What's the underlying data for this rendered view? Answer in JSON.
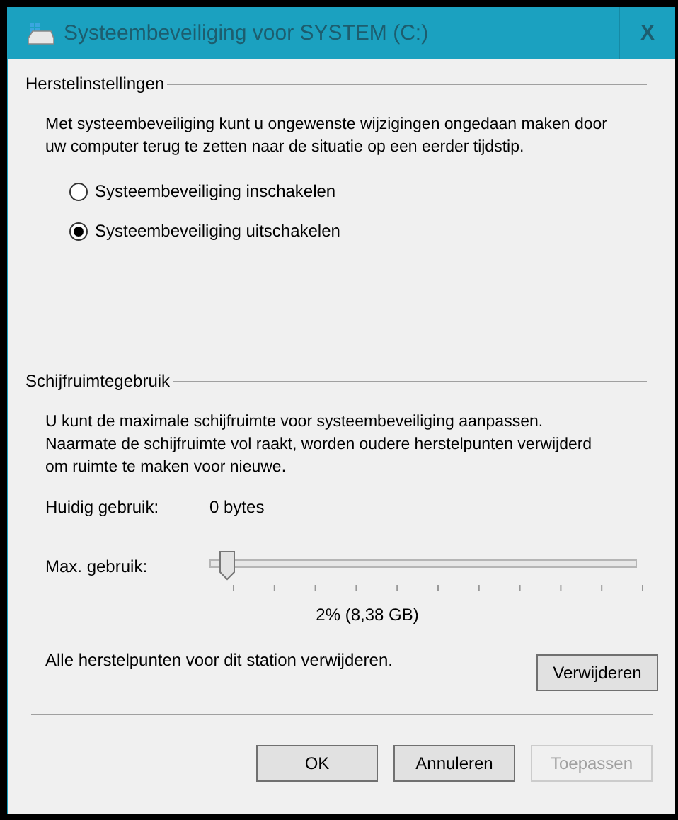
{
  "window": {
    "title": "Systeembeveiliging voor SYSTEM (C:)",
    "close": "X"
  },
  "restore_settings": {
    "heading": "Herstelinstellingen",
    "description": "Met systeembeveiliging kunt u ongewenste wijzigingen ongedaan maken door uw computer terug te zetten naar de situatie op een eerder tijdstip.",
    "options": [
      {
        "label": "Systeembeveiliging inschakelen",
        "selected": false
      },
      {
        "label": "Systeembeveiliging uitschakelen",
        "selected": true
      }
    ]
  },
  "disk_usage": {
    "heading": "Schijfruimtegebruik",
    "description": "U kunt de maximale schijfruimte voor systeembeveiliging aanpassen.\nNaarmate de schijfruimte vol raakt, worden oudere herstelpunten verwijderd om ruimte te maken voor nieuwe.",
    "current_label": "Huidig gebruik:",
    "current_value": "0 bytes",
    "max_label": "Max. gebruik:",
    "max_slider": {
      "level": 0.03
    },
    "max_reading": "2% (8,38 GB)",
    "delete_text": "Alle herstelpunten voor dit station verwijderen.",
    "delete_button": "Verwijderen"
  },
  "buttons": [
    {
      "label": "OK",
      "disabled": false
    },
    {
      "label": "Annuleren",
      "disabled": false
    },
    {
      "label": "Toepassen",
      "disabled": true
    }
  ]
}
